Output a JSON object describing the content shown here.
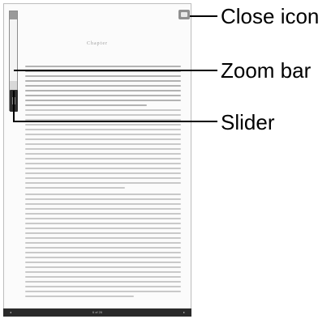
{
  "reader": {
    "page_title": "Chapter",
    "status": {
      "page_indicator": "6 of 26",
      "nav_left": "◂",
      "nav_right": "▸"
    }
  },
  "icons": {
    "close": "close-icon",
    "zoom_bar": "zoom-bar",
    "slider": "slider-handle"
  },
  "callouts": {
    "close": "Close icon",
    "zoom": "Zoom bar",
    "slider": "Slider"
  },
  "colors": {
    "device_border": "#bdbdbd",
    "status_bar": "#2a2a2a",
    "slider": "#2f2f2f"
  }
}
